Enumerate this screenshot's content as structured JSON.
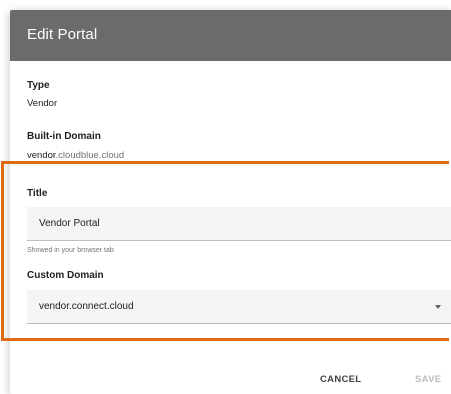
{
  "dialog": {
    "title": "Edit Portal"
  },
  "fields": {
    "type": {
      "label": "Type",
      "value": "Vendor"
    },
    "builtin_domain": {
      "label": "Built-in Domain",
      "value_prefix": "vendor",
      "value_suffix": ".cloudblue.cloud"
    },
    "title": {
      "label": "Title",
      "value": "Vendor Portal",
      "helper": "Showed in your browser tab"
    },
    "custom_domain": {
      "label": "Custom Domain",
      "value": "vendor.connect.cloud"
    }
  },
  "actions": {
    "cancel_label": "CANCEL",
    "save_label": "SAVE"
  },
  "colors": {
    "header_bg": "#6b6b6b",
    "highlight": "#e06a15",
    "save_disabled": "#bdbdbd"
  },
  "icons": {
    "select_arrow": "caret-down-icon"
  }
}
